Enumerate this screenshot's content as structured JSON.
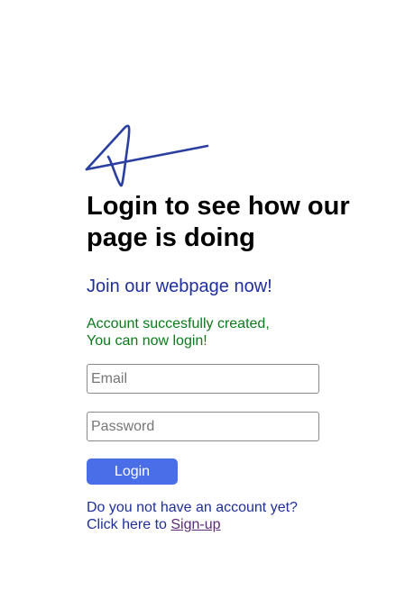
{
  "logo": {
    "icon": "signature-logo-icon"
  },
  "heading": "Login to see how our page is doing",
  "subheading": "Join our webpage now!",
  "success_message": {
    "line1": "Account succesfully created,",
    "line2": "You can now login!"
  },
  "form": {
    "email_placeholder": "Email",
    "password_placeholder": "Password",
    "login_label": "Login"
  },
  "signup": {
    "question": "Do you not have an account yet?",
    "prefix": "Click here to ",
    "link_label": "Sign-up"
  },
  "colors": {
    "heading": "#000000",
    "accent_blue": "#1f2f9c",
    "success_green": "#0a7a1a",
    "button_bg": "#4a6ee8",
    "link": "#5b2a7a"
  }
}
